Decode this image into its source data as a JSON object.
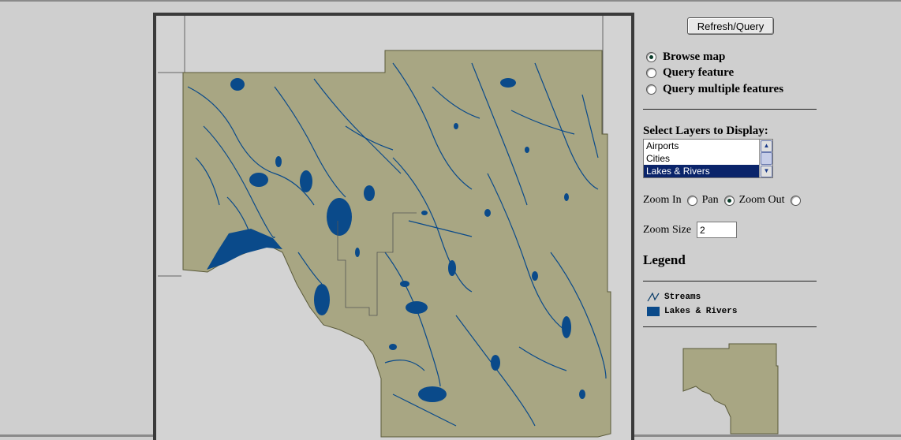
{
  "toolbar": {
    "refresh_label": "Refresh/Query"
  },
  "modes": [
    {
      "label": "Browse map",
      "selected": true
    },
    {
      "label": "Query feature",
      "selected": false
    },
    {
      "label": "Query multiple features",
      "selected": false
    }
  ],
  "layers": {
    "label": "Select Layers to Display:",
    "items": [
      {
        "label": "Airports",
        "selected": false
      },
      {
        "label": "Cities",
        "selected": false
      },
      {
        "label": "Lakes & Rivers",
        "selected": true
      }
    ]
  },
  "zoom": {
    "options": [
      {
        "label": "Zoom In",
        "selected": false
      },
      {
        "label": "Pan",
        "selected": true
      },
      {
        "label": "Zoom Out",
        "selected": false
      }
    ],
    "size_label": "Zoom Size",
    "size_value": "2"
  },
  "legend": {
    "title": "Legend",
    "items": [
      {
        "label": "Streams",
        "icon": "stream-line-icon"
      },
      {
        "label": "Lakes & Rivers",
        "icon": "lake-fill-icon"
      }
    ]
  },
  "colors": {
    "land": "#a8a683",
    "water": "#0a4a8a",
    "background": "#cfcfcf",
    "selection": "#0a246a"
  }
}
